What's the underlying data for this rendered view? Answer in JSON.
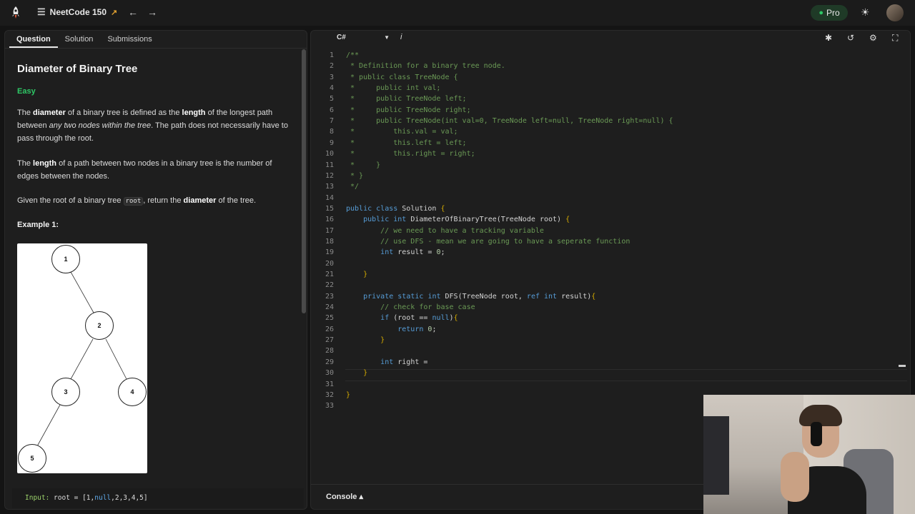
{
  "topbar": {
    "brand": "NeetCode 150",
    "pro_label": "Pro"
  },
  "tabs": [
    {
      "label": "Question"
    },
    {
      "label": "Solution"
    },
    {
      "label": "Submissions"
    }
  ],
  "question": {
    "title": "Diameter of Binary Tree",
    "difficulty": "Easy",
    "p1": {
      "a": "The ",
      "b": "diameter",
      "c": " of a binary tree is defined as the ",
      "d": "length",
      "e": " of the longest path between ",
      "f": "any two nodes within the tree",
      "g": ". The path does not necessarily have to pass through the root."
    },
    "p2": {
      "a": "The ",
      "b": "length",
      "c": " of a path between two nodes in a binary tree is the number of edges between the nodes."
    },
    "p3": {
      "a": "Given the root of a binary tree ",
      "code": "root",
      "c": ", return the ",
      "d": "diameter",
      "e": " of the tree."
    },
    "example_heading": "Example 1:",
    "tree_nodes": [
      "1",
      "2",
      "3",
      "4",
      "5"
    ],
    "input": {
      "label": "Input:",
      "a": " root = [1,",
      "null": "null",
      "b": ",2,3,4,5]"
    }
  },
  "editor": {
    "language": "C#",
    "console_label": "Console",
    "lines": [
      "/**",
      " * Definition for a binary tree node.",
      " * public class TreeNode {",
      " *     public int val;",
      " *     public TreeNode left;",
      " *     public TreeNode right;",
      " *     public TreeNode(int val=0, TreeNode left=null, TreeNode right=null) {",
      " *         this.val = val;",
      " *         this.left = left;",
      " *         this.right = right;",
      " *     }",
      " * }",
      " */",
      "",
      "public class Solution {",
      "    public int DiameterOfBinaryTree(TreeNode root) {",
      "        // we need to have a tracking variable",
      "        // use DFS - mean we are going to have a seperate function",
      "        int result = 0;",
      "",
      "    }",
      "",
      "    private static int DFS(TreeNode root, ref int result){",
      "        // check for base case",
      "        if (root == null){",
      "            return 0;",
      "        }",
      "",
      "        int right =",
      "    }",
      "",
      "}",
      ""
    ]
  }
}
